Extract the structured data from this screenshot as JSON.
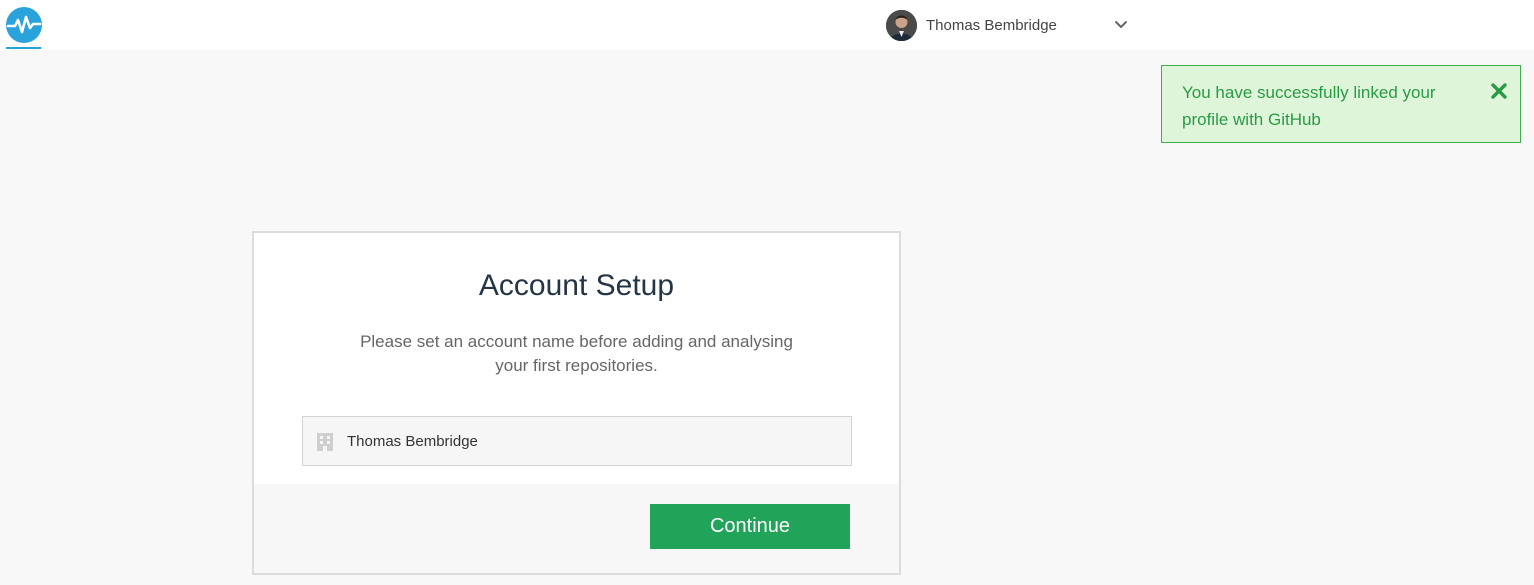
{
  "app": {
    "logo_icon": "pulse-icon",
    "accent_color": "#2aa3dc"
  },
  "header": {
    "user_name": "Thomas Bembridge",
    "avatar_icon": "user-avatar",
    "menu_icon": "chevron-down-icon"
  },
  "notification": {
    "message": "You have successfully linked your profile with GitHub",
    "close_icon": "close-icon",
    "status_color": "#2a9a45"
  },
  "setup": {
    "title": "Account Setup",
    "description": "Please set an account name before adding and analysing your first repositories.",
    "account_name_value": "Thomas Bembridge",
    "field_icon": "building-icon",
    "continue_label": "Continue",
    "button_color": "#22a35a"
  }
}
